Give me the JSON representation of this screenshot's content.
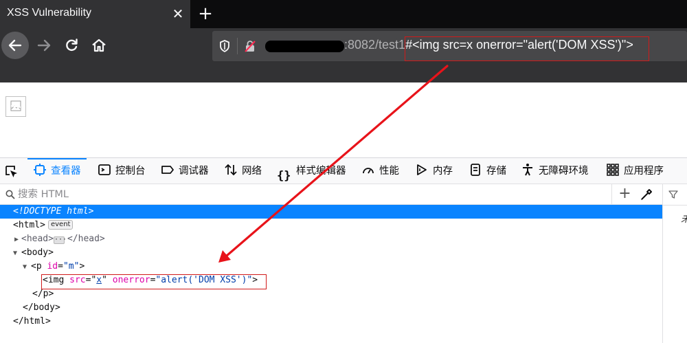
{
  "browser": {
    "tab_title": "XSS Vulnerability",
    "tab_close": "✕",
    "new_tab": "+",
    "url_host_port": ":8082/test1",
    "url_fragment": "#<img src=x onerror=\"alert('DOM XSS')\">"
  },
  "devtools": {
    "tabs": [
      {
        "label": "查看器",
        "icon": "inspector-icon"
      },
      {
        "label": "控制台",
        "icon": "console-icon"
      },
      {
        "label": "调试器",
        "icon": "debugger-icon"
      },
      {
        "label": "网络",
        "icon": "network-icon"
      },
      {
        "label": "样式编辑器",
        "icon": "style-editor-icon"
      },
      {
        "label": "性能",
        "icon": "performance-icon"
      },
      {
        "label": "内存",
        "icon": "memory-icon"
      },
      {
        "label": "存储",
        "icon": "storage-icon"
      },
      {
        "label": "无障碍环境",
        "icon": "accessibility-icon"
      },
      {
        "label": "应用程序",
        "icon": "application-icon"
      }
    ],
    "search_placeholder": "搜索 HTML",
    "add_button": "+",
    "side_text": "未",
    "tree": {
      "doctype": "<!DOCTYPE html>",
      "html_open": "<html>",
      "event_badge": "event",
      "head_open": "<head>",
      "head_close": "</head>",
      "body_open": "<body>",
      "p_tag": "<p",
      "p_attr_name": "id",
      "p_attr_value": "\"m\"",
      "img_tag": "<img",
      "img_src_name": "src",
      "img_src_value": "x",
      "img_onerror_name": "onerror",
      "img_onerror_value": "\"alert('DOM XSS')\"",
      "img_close": ">",
      "p_close": "</p>",
      "body_close": "</body>",
      "html_close": "</html>"
    }
  },
  "colors": {
    "annotation": "#d11a1a",
    "accent": "#0a84ff"
  }
}
